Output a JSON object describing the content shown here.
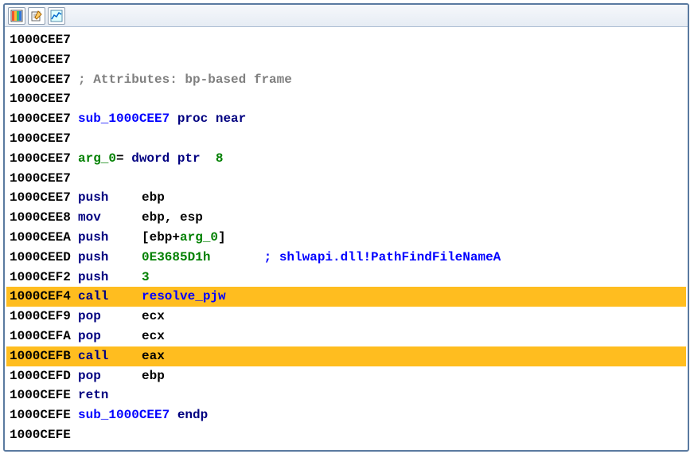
{
  "toolbar": {
    "icons": [
      "color-palette-icon",
      "edit-note-icon",
      "graph-icon"
    ]
  },
  "lines": [
    {
      "addr": "1000CEE7",
      "hl": false,
      "segs": []
    },
    {
      "addr": "1000CEE7",
      "hl": false,
      "segs": []
    },
    {
      "addr": "1000CEE7",
      "hl": false,
      "segs": [
        {
          "t": "; Attributes: bp-based frame",
          "c": "comment"
        }
      ]
    },
    {
      "addr": "1000CEE7",
      "hl": false,
      "segs": []
    },
    {
      "addr": "1000CEE7",
      "hl": false,
      "segs": [
        {
          "t": "sub_1000CEE7",
          "c": "proc"
        },
        {
          "t": " ",
          "c": "sp"
        },
        {
          "t": "proc near",
          "c": "mnem"
        }
      ]
    },
    {
      "addr": "1000CEE7",
      "hl": false,
      "segs": []
    },
    {
      "addr": "1000CEE7",
      "hl": false,
      "segs": [
        {
          "t": "arg_0",
          "c": "arg"
        },
        {
          "t": "= ",
          "c": "sp"
        },
        {
          "t": "dword ptr",
          "c": "mnem"
        },
        {
          "t": "  ",
          "c": "sp"
        },
        {
          "t": "8",
          "c": "num"
        }
      ]
    },
    {
      "addr": "1000CEE7",
      "hl": false,
      "segs": []
    },
    {
      "addr": "1000CEE7",
      "hl": false,
      "segs": [
        {
          "t": "push",
          "c": "mnem",
          "w": 8
        },
        {
          "t": "ebp",
          "c": "reg"
        }
      ]
    },
    {
      "addr": "1000CEE8",
      "hl": false,
      "segs": [
        {
          "t": "mov",
          "c": "mnem",
          "w": 8
        },
        {
          "t": "ebp, esp",
          "c": "reg"
        }
      ]
    },
    {
      "addr": "1000CEEA",
      "hl": false,
      "segs": [
        {
          "t": "push",
          "c": "mnem",
          "w": 8
        },
        {
          "t": "[ebp+",
          "c": "reg"
        },
        {
          "t": "arg_0",
          "c": "arg"
        },
        {
          "t": "]",
          "c": "reg"
        }
      ]
    },
    {
      "addr": "1000CEED",
      "hl": false,
      "segs": [
        {
          "t": "push",
          "c": "mnem",
          "w": 8
        },
        {
          "t": "0E3685D1h",
          "c": "num",
          "w": 16
        },
        {
          "t": "; shlwapi.dll!PathFindFileNameA",
          "c": "comment-blue"
        }
      ]
    },
    {
      "addr": "1000CEF2",
      "hl": false,
      "segs": [
        {
          "t": "push",
          "c": "mnem",
          "w": 8
        },
        {
          "t": "3",
          "c": "num"
        }
      ]
    },
    {
      "addr": "1000CEF4",
      "hl": true,
      "segs": [
        {
          "t": "call",
          "c": "mnem",
          "w": 8
        },
        {
          "t": "resolve_pjw",
          "c": "proc"
        }
      ]
    },
    {
      "addr": "1000CEF9",
      "hl": false,
      "segs": [
        {
          "t": "pop",
          "c": "mnem",
          "w": 8
        },
        {
          "t": "ecx",
          "c": "reg"
        }
      ]
    },
    {
      "addr": "1000CEFA",
      "hl": false,
      "segs": [
        {
          "t": "pop",
          "c": "mnem",
          "w": 8
        },
        {
          "t": "ecx",
          "c": "reg"
        }
      ]
    },
    {
      "addr": "1000CEFB",
      "hl": true,
      "segs": [
        {
          "t": "call",
          "c": "mnem",
          "w": 8
        },
        {
          "t": "eax",
          "c": "reg"
        }
      ]
    },
    {
      "addr": "1000CEFD",
      "hl": false,
      "segs": [
        {
          "t": "pop",
          "c": "mnem",
          "w": 8
        },
        {
          "t": "ebp",
          "c": "reg"
        }
      ]
    },
    {
      "addr": "1000CEFE",
      "hl": false,
      "segs": [
        {
          "t": "retn",
          "c": "mnem"
        }
      ]
    },
    {
      "addr": "1000CEFE",
      "hl": false,
      "segs": [
        {
          "t": "sub_1000CEE7",
          "c": "proc"
        },
        {
          "t": " ",
          "c": "sp"
        },
        {
          "t": "endp",
          "c": "mnem"
        }
      ]
    },
    {
      "addr": "1000CEFE",
      "hl": false,
      "segs": []
    }
  ]
}
